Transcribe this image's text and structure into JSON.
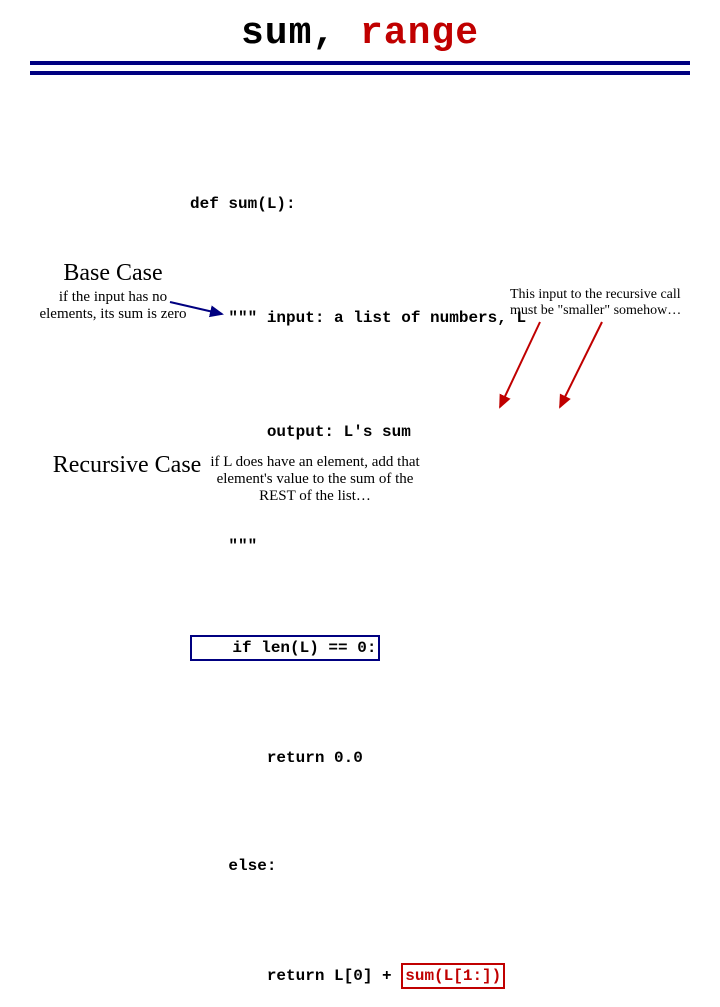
{
  "title": {
    "w1": "sum,",
    "w2": "range"
  },
  "code": {
    "l0": "def sum(L):",
    "l1": "    \"\"\" input: a list of numbers, L",
    "l2": "        output: L's sum",
    "l3": "    \"\"\"",
    "l4a": "    if len(L) == 0:",
    "l5": "        return 0.0",
    "l6": "    else:",
    "l7a": "        return L[0] + ",
    "l7b": "sum(L[1:])"
  },
  "base": {
    "heading": "Base Case",
    "sub": "if the input has no elements, its sum is zero"
  },
  "recursive": {
    "heading": "Recursive Case",
    "sub": "if L does have an element, add that element's value to the sum of the REST of the list…"
  },
  "note": {
    "smaller": "This input to the recursive call must be \"smaller\" somehow…"
  }
}
